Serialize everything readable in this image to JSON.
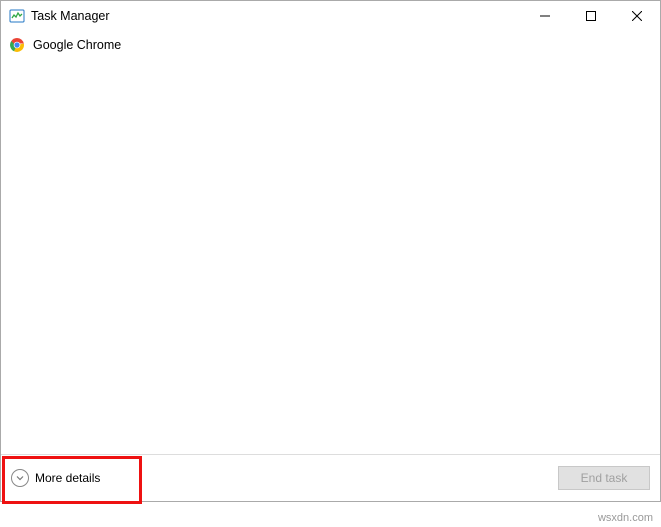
{
  "window": {
    "title": "Task Manager"
  },
  "processes": [
    {
      "name": "Google Chrome",
      "icon": "chrome-icon"
    }
  ],
  "footer": {
    "more_details_label": "More details",
    "end_task_label": "End task"
  },
  "watermark": "wsxdn.com"
}
